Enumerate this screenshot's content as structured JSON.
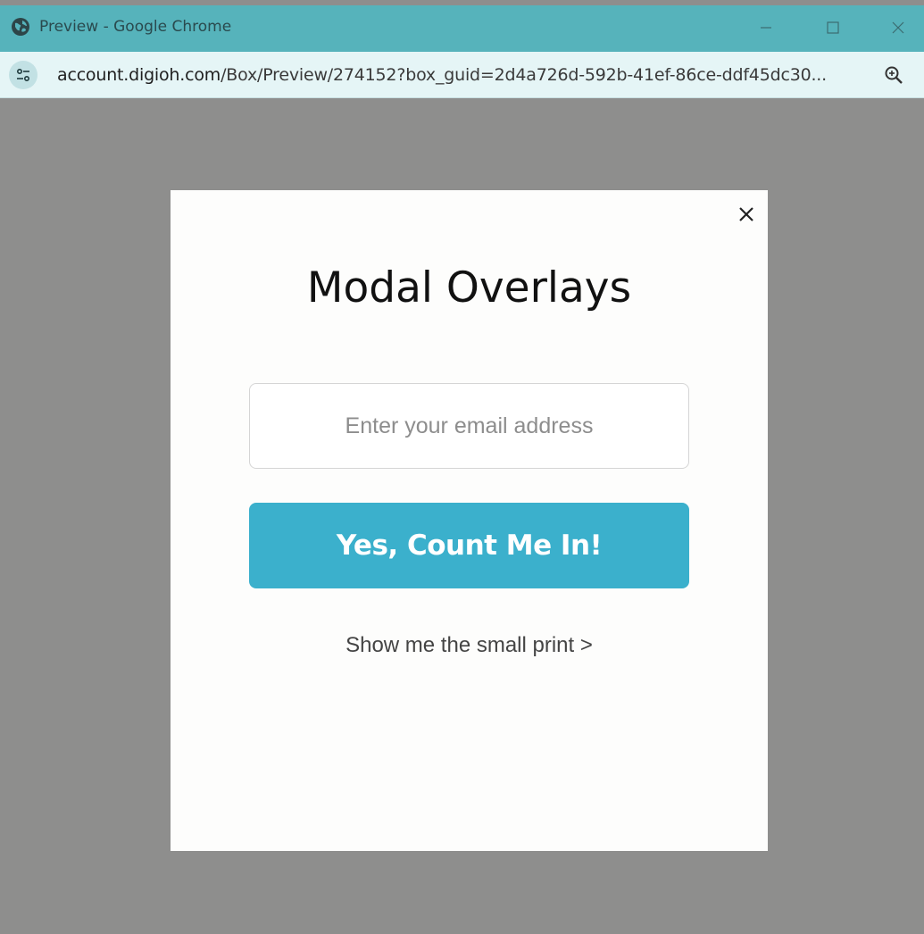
{
  "window": {
    "title": "Preview - Google Chrome",
    "title_icon": "globe-icon"
  },
  "addressbar": {
    "site_info_icon": "tune-icon",
    "url_domain": "account.digioh.com",
    "url_path": "/Box/Preview/274152?box_guid=2d4a726d-592b-41ef-86ce-ddf45dc30...",
    "zoom_icon": "zoom-icon"
  },
  "modal": {
    "title": "Modal Overlays",
    "email_placeholder": "Enter your email address",
    "email_value": "",
    "cta_label": "Yes, Count Me In!",
    "small_print_link": "Show me the small print >",
    "close_icon": "close-icon"
  },
  "colors": {
    "titlebar": "#56b3bb",
    "addressbar": "#e5f5f6",
    "overlay": "#8e8e8d",
    "cta": "#3bb0cc",
    "modal_bg": "#fdfdfc"
  }
}
